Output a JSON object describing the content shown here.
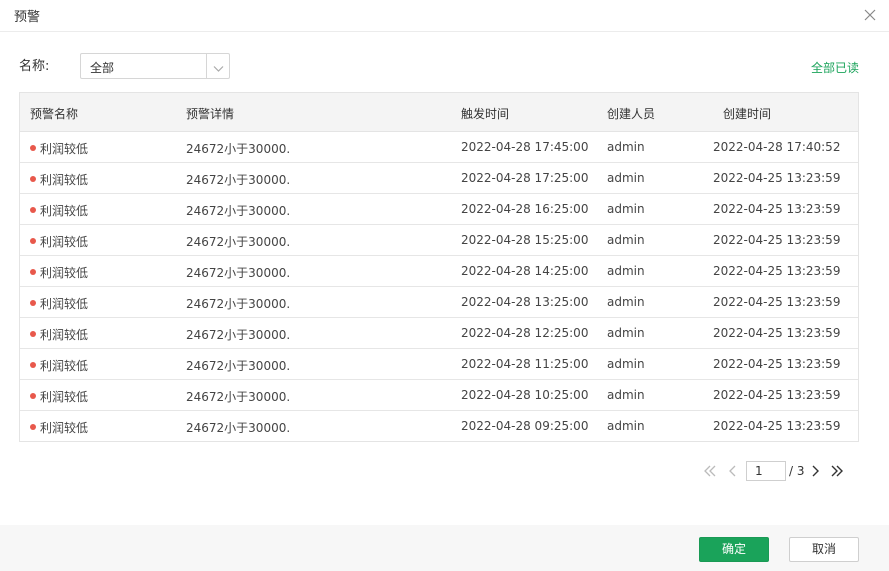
{
  "dialog": {
    "title": "预警"
  },
  "filter": {
    "label": "名称:",
    "value": "全部"
  },
  "actions": {
    "mark_all_read": "全部已读"
  },
  "table": {
    "headers": [
      "预警名称",
      "预警详情",
      "触发时间",
      "创建人员",
      "创建时间"
    ],
    "rows": [
      [
        "利润较低",
        "24672小于30000.",
        "2022-04-28 17:45:00",
        "admin",
        "2022-04-28 17:40:52"
      ],
      [
        "利润较低",
        "24672小于30000.",
        "2022-04-28 17:25:00",
        "admin",
        "2022-04-25 13:23:59"
      ],
      [
        "利润较低",
        "24672小于30000.",
        "2022-04-28 16:25:00",
        "admin",
        "2022-04-25 13:23:59"
      ],
      [
        "利润较低",
        "24672小于30000.",
        "2022-04-28 15:25:00",
        "admin",
        "2022-04-25 13:23:59"
      ],
      [
        "利润较低",
        "24672小于30000.",
        "2022-04-28 14:25:00",
        "admin",
        "2022-04-25 13:23:59"
      ],
      [
        "利润较低",
        "24672小于30000.",
        "2022-04-28 13:25:00",
        "admin",
        "2022-04-25 13:23:59"
      ],
      [
        "利润较低",
        "24672小于30000.",
        "2022-04-28 12:25:00",
        "admin",
        "2022-04-25 13:23:59"
      ],
      [
        "利润较低",
        "24672小于30000.",
        "2022-04-28 11:25:00",
        "admin",
        "2022-04-25 13:23:59"
      ],
      [
        "利润较低",
        "24672小于30000.",
        "2022-04-28 10:25:00",
        "admin",
        "2022-04-25 13:23:59"
      ],
      [
        "利润较低",
        "24672小于30000.",
        "2022-04-28 09:25:00",
        "admin",
        "2022-04-25 13:23:59"
      ]
    ]
  },
  "pagination": {
    "current": "1",
    "total_label": "/ 3"
  },
  "footer": {
    "ok_label": "确定",
    "cancel_label": "取消"
  },
  "colors": {
    "accent": "#1aa35a",
    "status_dot": "#e8584b"
  }
}
